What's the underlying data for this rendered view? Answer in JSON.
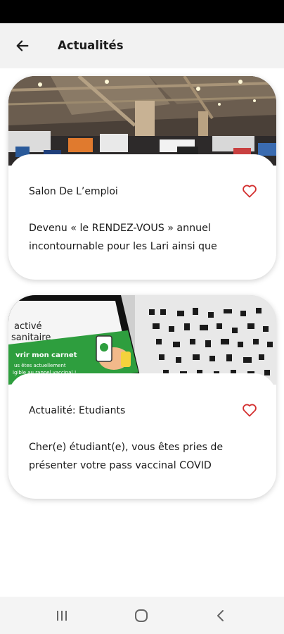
{
  "header": {
    "title": "Actualités",
    "back_icon": "arrow-left-icon"
  },
  "cards": [
    {
      "title": "Salon De L’emploi",
      "description": "Devenu « le RENDEZ-VOUS » annuel incontournable pour les Lari ainsi que",
      "image": "job-fair-hall-photo",
      "favorite_icon": "heart-outline-icon"
    },
    {
      "title": "Actualité: Etudiants",
      "description": "Cher(e) étudiant(e), vous êtes pries de présenter votre pass vaccinal COVID",
      "image": "vaccine-pass-phone-photo",
      "favorite_icon": "heart-outline-icon",
      "image_text": {
        "line1": "activé",
        "line2": "sanitaire",
        "banner1": "vrir mon carnet",
        "banner2": "us êtes actuellement",
        "banner3": "igible au rappel vaccinal !"
      }
    }
  ],
  "colors": {
    "accent_red": "#d32f2f",
    "app_bar": "#f2f2f2",
    "vaccine_green": "#2e9e3e"
  },
  "system_nav": {
    "recent_icon": "recent-apps-icon",
    "home_icon": "home-circle-icon",
    "back_icon": "system-back-icon"
  }
}
